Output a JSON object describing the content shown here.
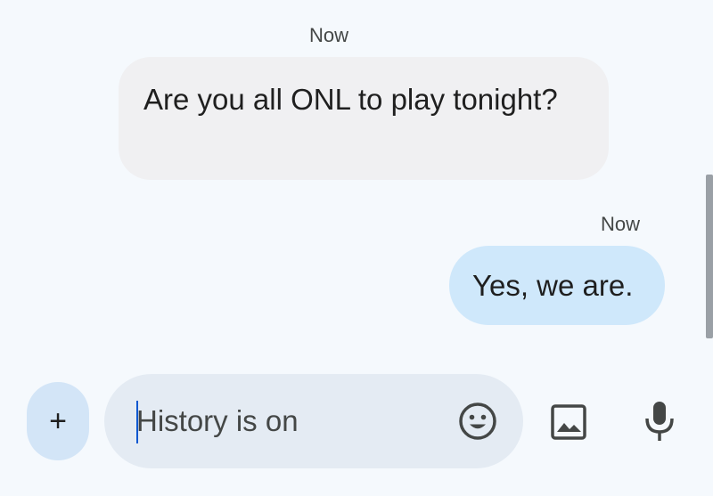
{
  "conversation": {
    "messages": [
      {
        "direction": "incoming",
        "timestamp": "Now",
        "text": "Are you all ONL to play tonight?"
      },
      {
        "direction": "outgoing",
        "timestamp": "Now",
        "text": "Yes, we are."
      }
    ]
  },
  "composer": {
    "add_label": "+",
    "placeholder": "History is on",
    "value": "",
    "icons": {
      "emoji": "emoji-icon",
      "gallery": "gallery-icon",
      "microphone": "microphone-icon"
    }
  },
  "colors": {
    "background": "#f5f9fd",
    "incoming_bubble": "#f0f0f2",
    "outgoing_bubble": "#cfe8fb",
    "composer": "#e4ebf3",
    "add_button": "#d3e5f7",
    "text": "#1f1f1f",
    "icon": "#444746"
  }
}
